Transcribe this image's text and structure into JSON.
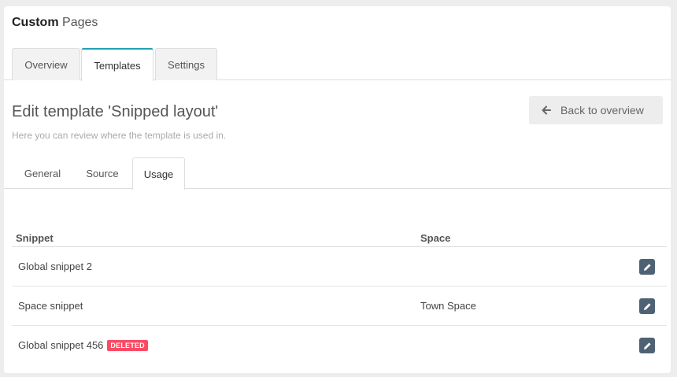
{
  "header": {
    "title_bold": "Custom",
    "title_light": "Pages"
  },
  "main_tabs": [
    {
      "label": "Overview",
      "active": false
    },
    {
      "label": "Templates",
      "active": true
    },
    {
      "label": "Settings",
      "active": false
    }
  ],
  "page": {
    "title": "Edit template 'Snipped layout'",
    "description": "Here you can review where the template is used in.",
    "back_label": "Back to overview"
  },
  "sub_tabs": [
    {
      "label": "General",
      "active": false
    },
    {
      "label": "Source",
      "active": false
    },
    {
      "label": "Usage",
      "active": true
    }
  ],
  "table": {
    "columns": [
      "Snippet",
      "Space"
    ],
    "rows": [
      {
        "snippet": "Global snippet 2",
        "space": "",
        "badge": ""
      },
      {
        "snippet": "Space snippet",
        "space": "Town Space",
        "badge": ""
      },
      {
        "snippet": "Global snippet 456",
        "space": "",
        "badge": "DELETED"
      }
    ]
  },
  "colors": {
    "accent": "#21a1b3",
    "badge_deleted": "#fc4a64",
    "edit_button": "#4f6273"
  },
  "icons": {
    "back": "arrow-left-icon",
    "edit": "pencil-icon"
  }
}
